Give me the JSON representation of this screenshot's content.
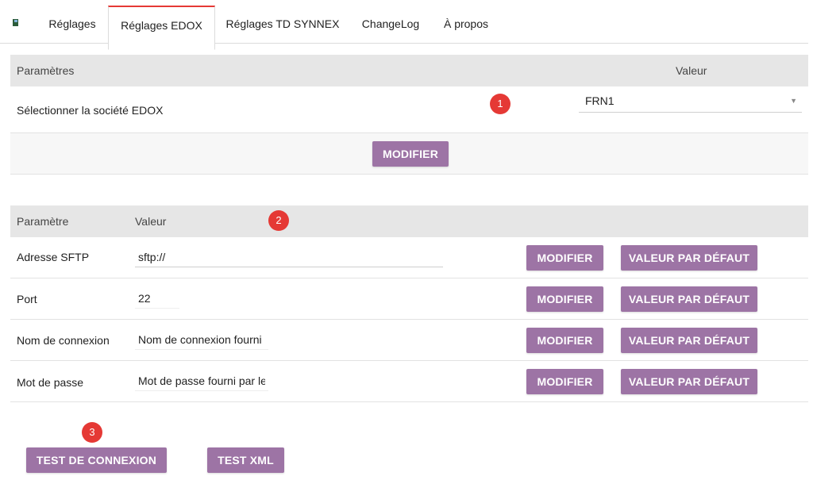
{
  "tabs": [
    {
      "label": "Réglages"
    },
    {
      "label": "Réglages EDOX"
    },
    {
      "label": "Réglages TD SYNNEX"
    },
    {
      "label": "ChangeLog"
    },
    {
      "label": "À propos"
    }
  ],
  "active_tab": "Réglages EDOX",
  "company_section": {
    "header_param": "Paramètres",
    "header_value": "Valeur",
    "row_label": "Sélectionner la société EDOX",
    "select_value": "FRN1",
    "modify_button": "MODIFIER",
    "badge": "1"
  },
  "sftp_section": {
    "header_param": "Paramètre",
    "header_value": "Valeur",
    "badge": "2",
    "rows": [
      {
        "label": "Adresse SFTP",
        "value": "sftp://",
        "modify": "MODIFIER",
        "default": "VALEUR PAR DÉFAUT"
      },
      {
        "label": "Port",
        "value": "22",
        "modify": "MODIFIER",
        "default": "VALEUR PAR DÉFAUT"
      },
      {
        "label": "Nom de connexion",
        "value": "Nom de connexion fourni p",
        "modify": "MODIFIER",
        "default": "VALEUR PAR DÉFAUT"
      },
      {
        "label": "Mot de passe",
        "value": "Mot de passe fourni par le f",
        "modify": "MODIFIER",
        "default": "VALEUR PAR DÉFAUT"
      }
    ]
  },
  "footer": {
    "badge": "3",
    "test_connection": "TEST DE CONNEXION",
    "test_xml": "TEST XML"
  },
  "colors": {
    "button": "#9d74a5",
    "badge": "#e53935",
    "header_bg": "#e6e6e6",
    "active_tab_border": "#e53935"
  }
}
